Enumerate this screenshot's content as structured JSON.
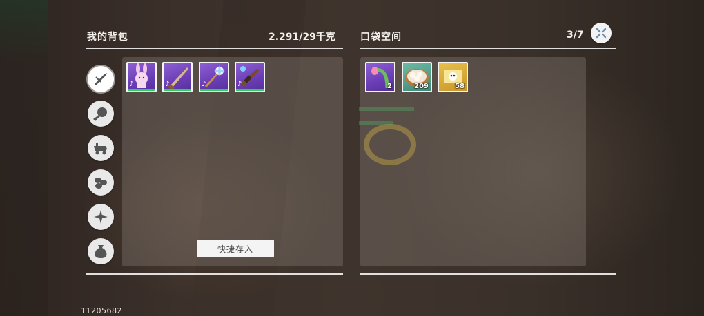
{
  "backpack": {
    "title": "我的背包",
    "weight": "2.291/29千克",
    "quick_store_label": "快捷存入",
    "categories": [
      {
        "icon": "weapon-icon",
        "active": true
      },
      {
        "icon": "food-icon",
        "active": false
      },
      {
        "icon": "vehicle-icon",
        "active": false
      },
      {
        "icon": "materials-icon",
        "active": false
      },
      {
        "icon": "sparkle-icon",
        "active": false
      },
      {
        "icon": "bag-icon",
        "active": false
      }
    ],
    "items": [
      {
        "icon": "bunny-plush-icon",
        "rarity": "purple"
      },
      {
        "icon": "rifle-icon",
        "rarity": "purple"
      },
      {
        "icon": "magic-wand-icon",
        "rarity": "purple"
      },
      {
        "icon": "assault-rifle-icon",
        "rarity": "purple"
      }
    ]
  },
  "pocket": {
    "title": "口袋空间",
    "capacity": "3/7",
    "items": [
      {
        "icon": "flower-bud-icon",
        "rarity": "purple",
        "count": "2"
      },
      {
        "icon": "dumplings-icon",
        "rarity": "teal",
        "count": "209"
      },
      {
        "icon": "ticket-icon",
        "rarity": "gold",
        "count": "58"
      }
    ]
  },
  "close_icon": "close-icon",
  "uid": "11205682",
  "colors": {
    "purple": "#7a4cc4",
    "teal": "#4f9c88",
    "gold": "#d8ab3a",
    "count_bar": "#2fd05f"
  }
}
